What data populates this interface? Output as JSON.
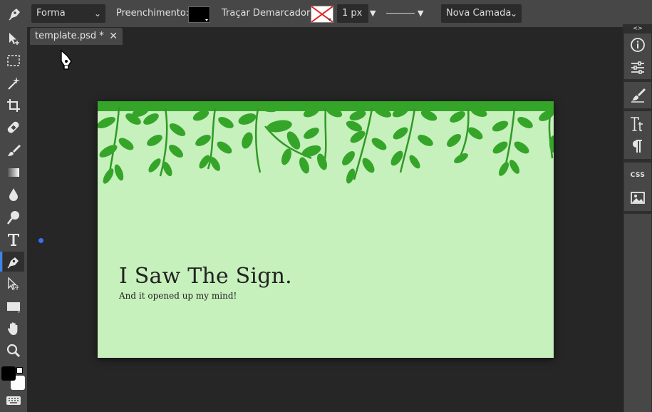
{
  "toolbar": {
    "shape_mode": "Forma",
    "fill_label": "Preenchimento:",
    "stroke_label": "Traçar Demarcador:",
    "stroke_width": "1 px",
    "layer_mode": "Nova Camada",
    "colors": {
      "fill": "#000000",
      "stroke_none": "#e02020"
    }
  },
  "tools": [
    "pen-tool-icon",
    "move-tool-icon",
    "marquee-tool-icon",
    "magic-wand-icon",
    "crop-icon",
    "healing-icon",
    "brush-icon",
    "gradient-icon",
    "blur-icon",
    "dodge-icon",
    "type-tool-icon",
    "pen-tool-icon",
    "path-select-icon",
    "rectangle-shape-icon",
    "hand-icon",
    "zoom-icon",
    "foreground-background-colors",
    "keyboard-icon"
  ],
  "tab": {
    "title": "template.psd *"
  },
  "canvas": {
    "background": "#c6f0bc",
    "headline": "I Saw The Sign.",
    "subline": "And it opened up my mind!"
  },
  "right_panel": {
    "collapse_label": "<>",
    "css_label": "CSS"
  }
}
